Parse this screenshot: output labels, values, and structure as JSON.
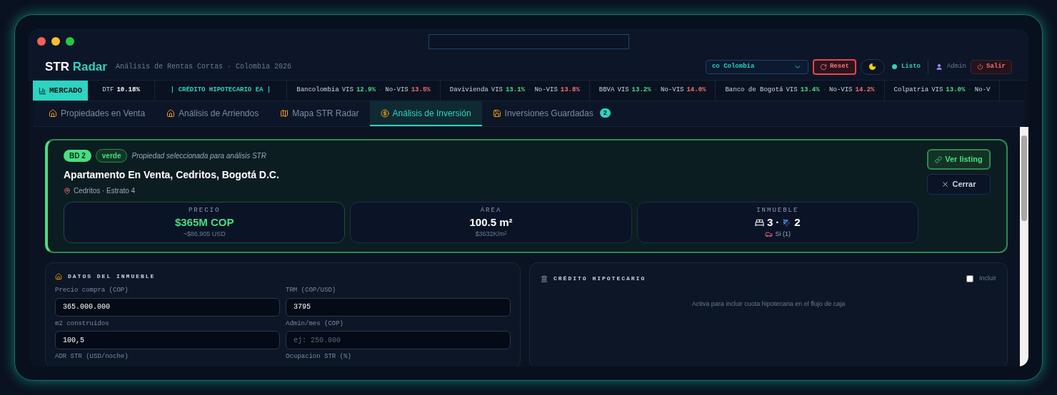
{
  "header": {
    "brand": {
      "first": "STR",
      "second": "Radar"
    },
    "subtitle": "Análisis de Rentas Cortas · Colombia 2026",
    "country": {
      "flag": "co",
      "value": "Colombia"
    },
    "reset": "Reset",
    "dark_mode": true,
    "status": {
      "label": "Listo",
      "color": "#2dd4bf"
    },
    "user": "Admin",
    "logout": "Salir"
  },
  "ticker": {
    "label": "MERCADO",
    "dtf": {
      "label": "DTF",
      "value": "10.18%"
    },
    "section": "| CRÉDITO HIPOTECARIO EA |",
    "separator": "·",
    "banks": [
      {
        "name": "Bancolombia",
        "vis": {
          "label": "VIS",
          "value": "12.9%"
        },
        "novis": {
          "label": "No-VIS",
          "value": "13.5%"
        }
      },
      {
        "name": "Davivienda",
        "vis": {
          "label": "VIS",
          "value": "13.1%"
        },
        "novis": {
          "label": "No-VIS",
          "value": "13.8%"
        }
      },
      {
        "name": "BBVA",
        "vis": {
          "label": "VIS",
          "value": "13.2%"
        },
        "novis": {
          "label": "No-VIS",
          "value": "14.0%"
        }
      },
      {
        "name": "Banco de Bogotá",
        "vis": {
          "label": "VIS",
          "value": "13.4%"
        },
        "novis": {
          "label": "No-VIS",
          "value": "14.2%"
        }
      },
      {
        "name": "Colpatria",
        "vis": {
          "label": "VIS",
          "value": "13.0%"
        },
        "novis": {
          "label": "No-V"
        }
      }
    ]
  },
  "tabs": [
    {
      "label": "Propiedades en Venta",
      "selected": false
    },
    {
      "label": "Análisis de Arriendos",
      "selected": false
    },
    {
      "label": "Mapa STR Radar",
      "selected": false
    },
    {
      "label": "Análisis de Inversión",
      "selected": true
    },
    {
      "label": "Inversiones Guardadas",
      "selected": false,
      "badge": "2"
    }
  ],
  "property": {
    "id": "BD 2",
    "tag": "verde",
    "note": "Propiedad seleccionada para análisis STR",
    "title": "Apartamento En Venta, Cedritos, Bogotá D.C.",
    "location": "Cedritos · Estrato 4",
    "stats": [
      {
        "kind": "price",
        "label": "PRECIO",
        "value": "$365M COP",
        "sub": "~$86,905 USD"
      },
      {
        "kind": "area",
        "label": "ÁREA",
        "value": "100.5 m²",
        "sub": "$3632K/m²"
      },
      {
        "kind": "rooms",
        "label": "INMUEBLE",
        "beds": "3",
        "sep": "·",
        "baths": "2",
        "parking": "Si (1)"
      }
    ],
    "view": "Ver listing",
    "close": "Cerrar"
  },
  "datos": {
    "title": "DATOS DEL INMUEBLE",
    "fields": [
      {
        "label": "Precio compra (COP)",
        "value": "365.000.000"
      },
      {
        "label": "TRM (COP/USD)",
        "value": "3795"
      },
      {
        "label": "m2 construidos",
        "value": "100,5"
      },
      {
        "label": "Admin/mes (COP)",
        "placeholder": "ej: 250.000"
      },
      {
        "label": "ADR STR (USD/noche)"
      },
      {
        "label": "Ocupacion STR (%)"
      }
    ]
  },
  "credito": {
    "title": "CRÉDITO HIPOTECARIO",
    "include": {
      "label": "Incluir",
      "checked": false
    },
    "hint": "Activa para incluir cuota hipotecaria en el flujo de caja"
  }
}
